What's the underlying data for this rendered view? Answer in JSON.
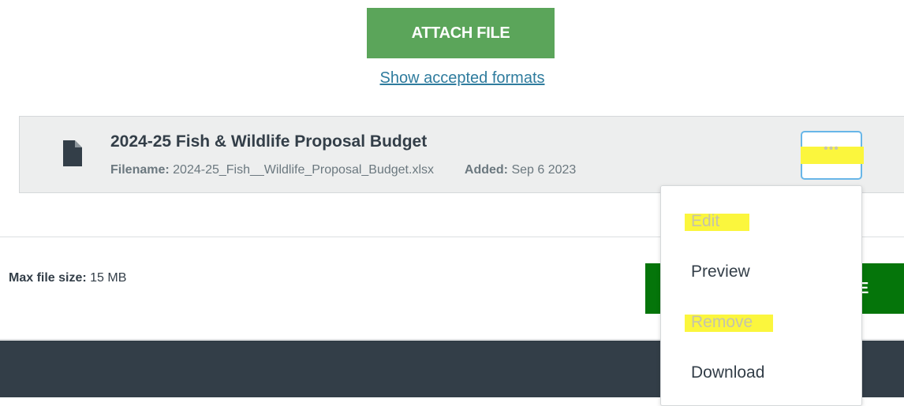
{
  "attach": {
    "button_label": "ATTACH FILE",
    "formats_link": "Show accepted formats"
  },
  "file": {
    "title": "2024-25 Fish & Wildlife Proposal Budget",
    "filename_label": "Filename:",
    "filename_value": "2024-25_Fish__Wildlife_Proposal_Budget.xlsx",
    "added_label": "Added:",
    "added_value": "Sep 6 2023",
    "more_button_glyph": "•••",
    "icon": "document-icon"
  },
  "footer": {
    "max_size_label": "Max file size:",
    "max_size_value": "15 MB",
    "save_button_label": "E"
  },
  "menu": {
    "items": [
      {
        "label": "Edit",
        "state": "disabled-highlighted"
      },
      {
        "label": "Preview",
        "state": "enabled"
      },
      {
        "label": "Remove",
        "state": "disabled-highlighted"
      },
      {
        "label": "Download",
        "state": "enabled"
      }
    ]
  },
  "colors": {
    "attach_button": "#5ba55a",
    "link": "#2f7c9e",
    "save_button": "#05750a",
    "footer_bar": "#333e48",
    "highlight": "#fbf63d",
    "focus_outline": "#68b6e8"
  }
}
